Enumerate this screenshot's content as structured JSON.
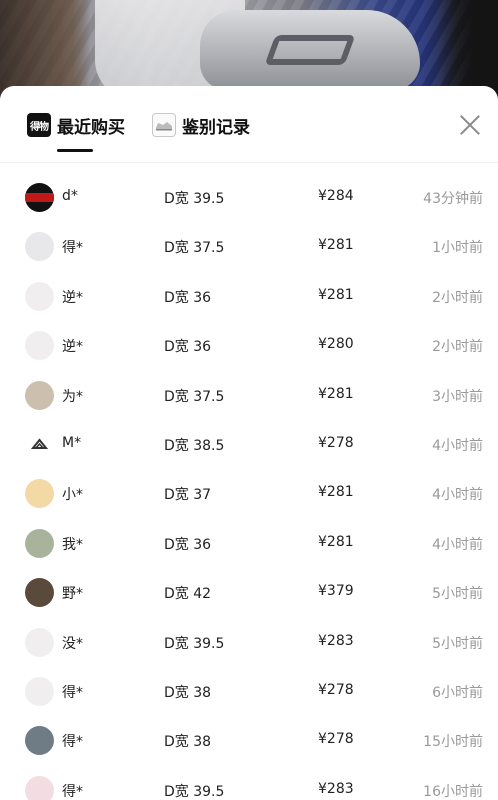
{
  "tabs": [
    {
      "label": "最近购买",
      "icon": "dewu-logo-icon",
      "icon_text": "得物",
      "active": true
    },
    {
      "label": "鉴别记录",
      "icon": "shoe-icon",
      "active": false
    }
  ],
  "purchases": [
    {
      "name": "d*",
      "size": "D宽 39.5",
      "price": "¥284",
      "time": "43分钟前"
    },
    {
      "name": "得*",
      "size": "D宽 37.5",
      "price": "¥281",
      "time": "1小时前"
    },
    {
      "name": "逆*",
      "size": "D宽 36",
      "price": "¥281",
      "time": "2小时前"
    },
    {
      "name": "逆*",
      "size": "D宽 36",
      "price": "¥280",
      "time": "2小时前"
    },
    {
      "name": "为*",
      "size": "D宽 37.5",
      "price": "¥281",
      "time": "3小时前"
    },
    {
      "name": "M*",
      "size": "D宽 38.5",
      "price": "¥278",
      "time": "4小时前"
    },
    {
      "name": "小*",
      "size": "D宽 37",
      "price": "¥281",
      "time": "4小时前"
    },
    {
      "name": "我*",
      "size": "D宽 36",
      "price": "¥281",
      "time": "4小时前"
    },
    {
      "name": "野*",
      "size": "D宽 42",
      "price": "¥379",
      "time": "5小时前"
    },
    {
      "name": "没*",
      "size": "D宽 39.5",
      "price": "¥283",
      "time": "5小时前"
    },
    {
      "name": "得*",
      "size": "D宽 38",
      "price": "¥278",
      "time": "6小时前"
    },
    {
      "name": "得*",
      "size": "D宽 38",
      "price": "¥278",
      "time": "15小时前"
    },
    {
      "name": "得*",
      "size": "D宽 39.5",
      "price": "¥283",
      "time": "16小时前"
    }
  ]
}
